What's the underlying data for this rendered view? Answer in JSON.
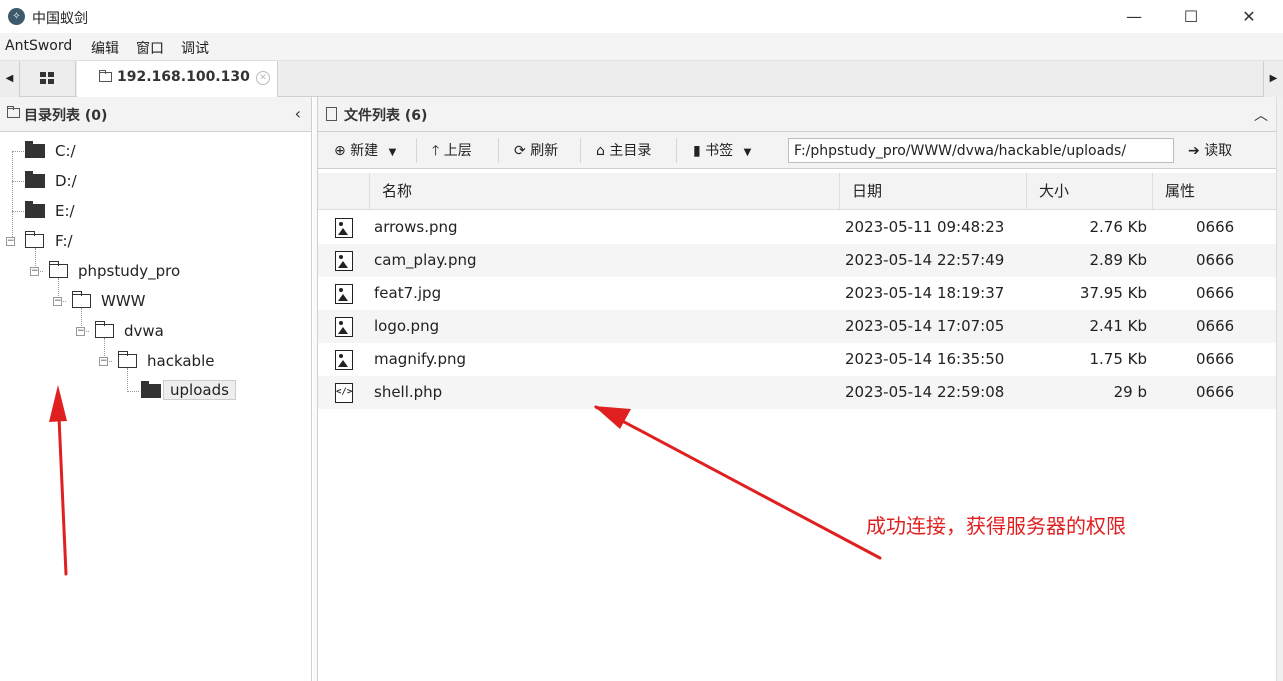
{
  "window": {
    "title": "中国蚁剑",
    "minimize": "—",
    "maximize": "☐",
    "close": "✕"
  },
  "menu": [
    "AntSword",
    "编辑",
    "窗口",
    "调试"
  ],
  "tabs": {
    "host": "192.168.100.130"
  },
  "left_panel": {
    "title": "目录列表 (0)",
    "tree": [
      {
        "label": "C:/"
      },
      {
        "label": "D:/"
      },
      {
        "label": "E:/"
      },
      {
        "label": "F:/"
      },
      {
        "label": "phpstudy_pro"
      },
      {
        "label": "WWW"
      },
      {
        "label": "dvwa"
      },
      {
        "label": "hackable"
      },
      {
        "label": "uploads"
      }
    ]
  },
  "right_panel": {
    "title": "文件列表 (6)",
    "toolbar": {
      "new": "新建",
      "up": "上层",
      "refresh": "刷新",
      "home": "主目录",
      "bookmark": "书签",
      "path": "F:/phpstudy_pro/WWW/dvwa/hackable/uploads/",
      "read": "读取"
    },
    "columns": [
      "名称",
      "日期",
      "大小",
      "属性"
    ],
    "files": [
      {
        "name": "arrows.png",
        "date": "2023-05-11 09:48:23",
        "size": "2.76 Kb",
        "perm": "0666",
        "icon": "image-file-icon"
      },
      {
        "name": "cam_play.png",
        "date": "2023-05-14 22:57:49",
        "size": "2.89 Kb",
        "perm": "0666",
        "icon": "image-file-icon"
      },
      {
        "name": "feat7.jpg",
        "date": "2023-05-14 18:19:37",
        "size": "37.95 Kb",
        "perm": "0666",
        "icon": "image-file-icon"
      },
      {
        "name": "logo.png",
        "date": "2023-05-14 17:07:05",
        "size": "2.41 Kb",
        "perm": "0666",
        "icon": "image-file-icon"
      },
      {
        "name": "magnify.png",
        "date": "2023-05-14 16:35:50",
        "size": "1.75 Kb",
        "perm": "0666",
        "icon": "image-file-icon"
      },
      {
        "name": "shell.php",
        "date": "2023-05-14 22:59:08",
        "size": "29 b",
        "perm": "0666",
        "icon": "code-file-icon"
      }
    ]
  },
  "annotation": {
    "text": "成功连接，获得服务器的权限",
    "color": "#e02020"
  }
}
